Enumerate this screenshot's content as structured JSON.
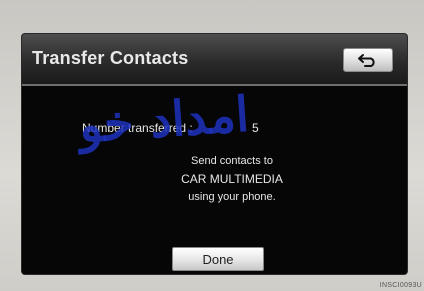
{
  "header": {
    "title": "Transfer Contacts",
    "back_icon": "back-arrow-icon"
  },
  "status": {
    "count_label": "Number transferred :",
    "count_value": "5"
  },
  "message": {
    "line1": "Send contacts to",
    "line2": "CAR MULTIMEDIA",
    "line3": "using your phone."
  },
  "footer": {
    "done_label": "Done"
  },
  "overlay": {
    "watermark_text": "امداد خو",
    "code": "INSCI0093U"
  },
  "colors": {
    "screen_bg": "#060606",
    "text": "#e6e6e6",
    "watermark": "#1e32be"
  }
}
